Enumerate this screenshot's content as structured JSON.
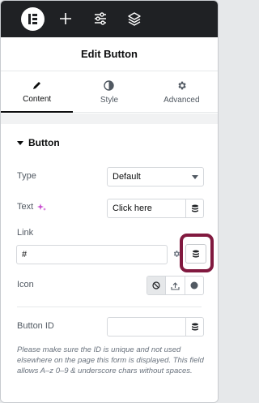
{
  "topbar": {
    "logo": "elementor-logo",
    "icons": [
      "plus-icon",
      "sliders-icon",
      "layers-icon"
    ]
  },
  "header": {
    "title": "Edit Button"
  },
  "tabs": [
    {
      "label": "Content",
      "icon": "pencil-icon",
      "active": true
    },
    {
      "label": "Style",
      "icon": "half-circle-icon",
      "active": false
    },
    {
      "label": "Advanced",
      "icon": "gear-icon",
      "active": false
    }
  ],
  "section": {
    "title": "Button"
  },
  "fields": {
    "type": {
      "label": "Type",
      "value": "Default"
    },
    "text": {
      "label": "Text",
      "value": "Click here"
    },
    "link": {
      "label": "Link",
      "value": "#"
    },
    "icon": {
      "label": "Icon"
    },
    "button_id": {
      "label": "Button ID",
      "value": ""
    }
  },
  "help_text": "Please make sure the ID is unique and not used elsewhere on the page this form is displayed. This field allows A–z  0–9 & underscore chars without spaces.",
  "colors": {
    "highlight": "#81193f",
    "topbar": "#1f2124"
  }
}
